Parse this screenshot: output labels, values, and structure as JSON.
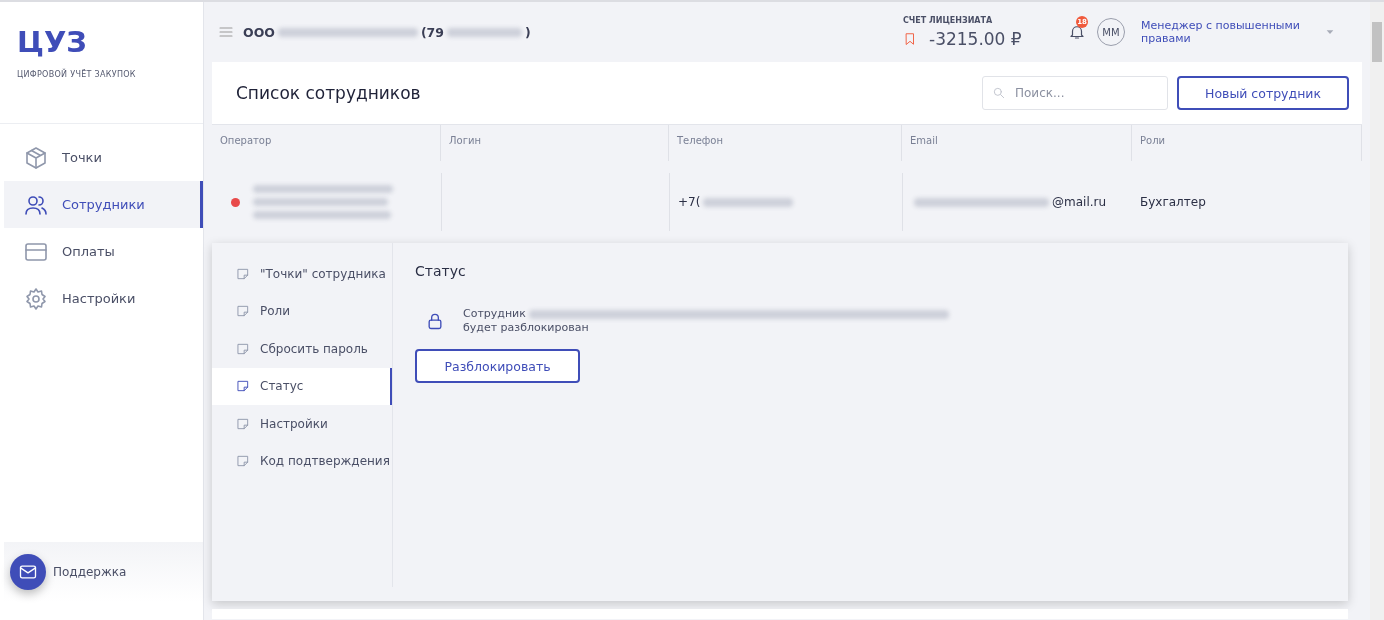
{
  "sidebar": {
    "logo": "ЦУЗ",
    "subtitle": "ЦИФРОВОЙ УЧЁТ ЗАКУПОК",
    "items": [
      {
        "label": "Точки",
        "selected": false
      },
      {
        "label": "Сотрудники",
        "selected": true
      },
      {
        "label": "Оплаты",
        "selected": false
      },
      {
        "label": "Настройки",
        "selected": false
      }
    ],
    "support": "Поддержка"
  },
  "header": {
    "org_prefix": "ООО",
    "org_phone_start": "(79",
    "org_phone_end": ")",
    "account_label": "СЧЕТ ЛИЦЕНЗИАТА",
    "balance": "-3215.00 ₽",
    "notifications": "18",
    "avatar": "ММ",
    "user": "Менеджер с повышенными правами"
  },
  "page": {
    "title": "Список сотрудников",
    "search": {
      "placeholder": "Поиск..."
    },
    "new_button": "Новый сотрудник"
  },
  "table": {
    "columns": [
      "Оператор",
      "Логин",
      "Телефон",
      "Email",
      "Роли"
    ],
    "rows": [
      {
        "color": "#e84a4a",
        "phone_start": "+7(",
        "email_end": "@mail.ru",
        "role": "Бухгалтер"
      }
    ]
  },
  "detail": {
    "menu": [
      {
        "label": "\"Точки\" сотрудника",
        "selected": false
      },
      {
        "label": "Роли",
        "selected": false
      },
      {
        "label": "Сбросить пароль",
        "selected": false
      },
      {
        "label": "Статус",
        "selected": true
      },
      {
        "label": "Настройки",
        "selected": false
      },
      {
        "label": "Код подтверждения",
        "selected": false
      }
    ],
    "title": "Статус",
    "message_start": "Сотрудник",
    "message_end": "будет разблокирован",
    "button": "Разблокировать"
  }
}
